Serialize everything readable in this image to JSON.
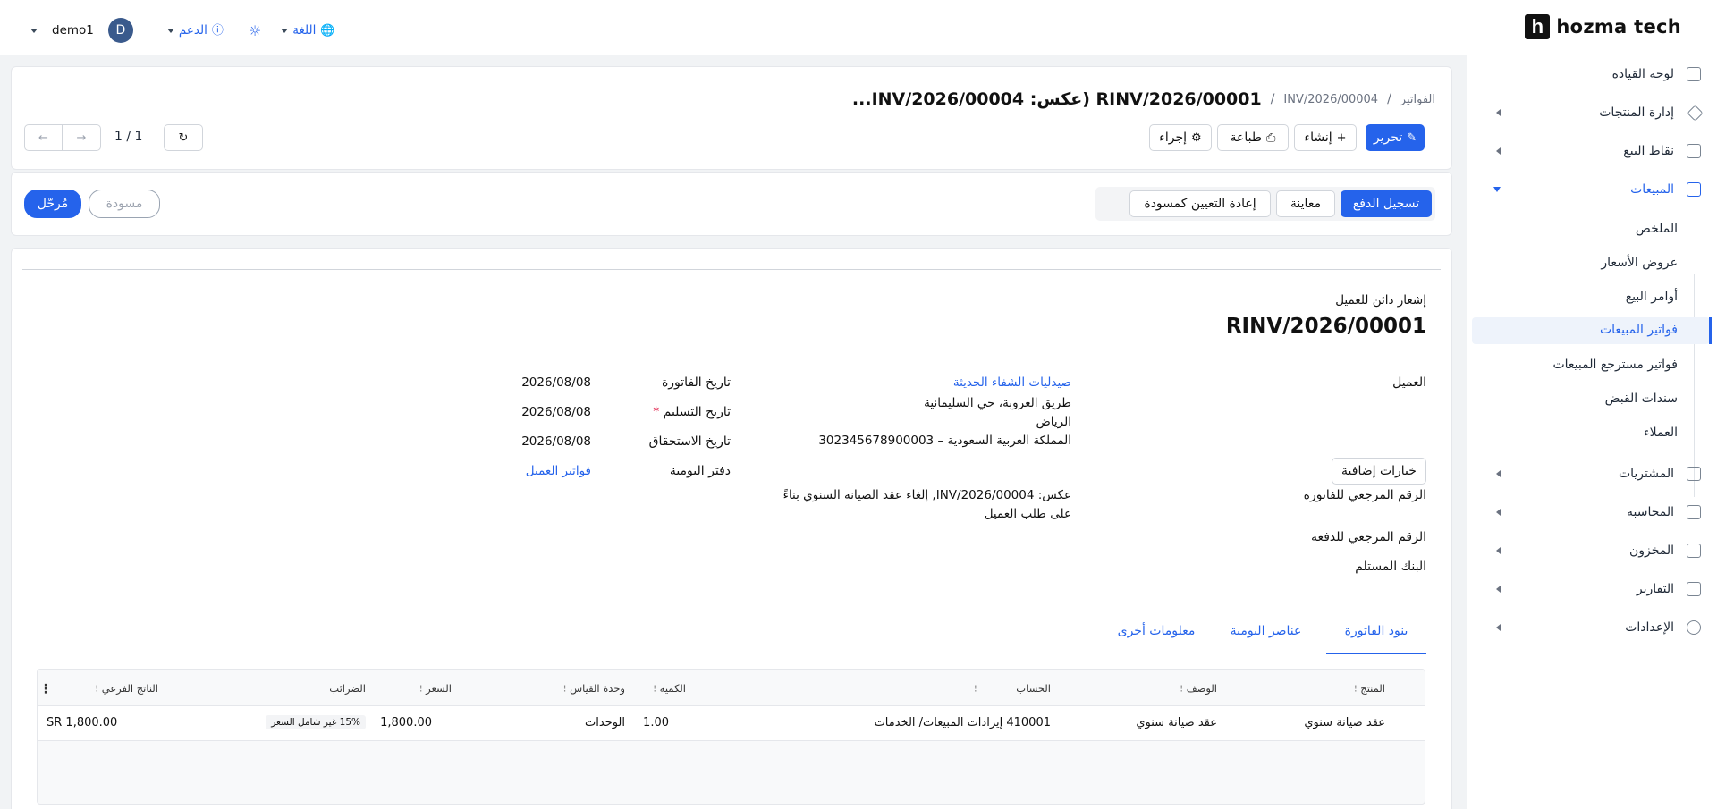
{
  "brand": {
    "logo_letter": "h",
    "name": "hozma tech"
  },
  "topnav": {
    "user": "demo1",
    "avatar_letter": "D",
    "support": "الدعم",
    "language": "اللغة"
  },
  "sidebar": {
    "items": [
      {
        "label": "لوحة القيادة",
        "icon": "dashboard-icon"
      },
      {
        "label": "إدارة المنتجات",
        "icon": "tag-icon"
      },
      {
        "label": "نقاط البيع",
        "icon": "store-icon"
      },
      {
        "label": "المبيعات",
        "icon": "chart-line-icon"
      },
      {
        "label": "المشتريات",
        "icon": "card-icon"
      },
      {
        "label": "المحاسبة",
        "icon": "ledger-icon"
      },
      {
        "label": "المخزون",
        "icon": "box-icon"
      },
      {
        "label": "التقارير",
        "icon": "report-icon"
      },
      {
        "label": "الإعدادات",
        "icon": "gear-icon"
      }
    ],
    "sales_sub": [
      "الملخص",
      "عروض الأسعار",
      "أوامر البيع",
      "فواتير المبيعات",
      "فواتير مسترجع المبيعات",
      "سندات القبض",
      "العملاء"
    ]
  },
  "header": {
    "bc_invoices": "الفواتير",
    "bc_inv": "INV/2026/00004",
    "sep": "/",
    "title": "RINV/2026/00001 (عكس: INV/2026/00004...",
    "edit": "تحرير",
    "create": "إنشاء",
    "print": "طباعة",
    "action": "إجراء",
    "pager": "1 / 1"
  },
  "statusbar": {
    "register_payment": "تسجيل الدفع",
    "preview": "معاينة",
    "reset_draft": "إعادة التعيين كمسودة",
    "draft": "مسودة",
    "posted": "مُرحّل"
  },
  "doc": {
    "type": "إشعار دائن للعميل",
    "number": "RINV/2026/00001",
    "customer_label": "العميل",
    "customer_name": "صيدليات الشفاء الحديثة",
    "address1": "طريق العروبة، حي السليمانية",
    "address2": "الرياض",
    "address3": "302345678900003 – المملكة العربية السعودية",
    "extra_options": "خيارات إضافية",
    "ref_label": "الرقم المرجعي للفاتورة",
    "ref_value1": "عكس: INV/2026/00004, إلغاء عقد الصيانة السنوي بناءً",
    "ref_value2": "على طلب العميل",
    "pay_ref_label": "الرقم المرجعي للدفعة",
    "bank_label": "البنك المستلم",
    "invoice_date_label": "تاريخ الفاتورة",
    "invoice_date": "2026/08/08",
    "delivery_date_label": "تاريخ التسليم",
    "delivery_date": "2026/08/08",
    "due_date_label": "تاريخ الاستحقاق",
    "due_date": "2026/08/08",
    "journal_label": "دفتر اليومية",
    "journal": "فواتير العميل"
  },
  "tabs": [
    "بنود الفاتورة",
    "عناصر اليومية",
    "معلومات أخرى"
  ],
  "table": {
    "headers": [
      "المنتج",
      "الوصف",
      "الحساب",
      "الكمية",
      "وحدة القياس",
      "السعر",
      "الضرائب",
      "الناتج الفرعي"
    ],
    "row": {
      "product": "عقد صيانة سنوي",
      "description": "عقد صيانة سنوي",
      "account": "410001 إيرادات المبيعات/ الخدمات",
      "qty": "1.00",
      "uom": "الوحدات",
      "price": "1,800.00",
      "tax": "15% غير شامل السعر",
      "subtotal": "SR 1,800.00"
    }
  }
}
